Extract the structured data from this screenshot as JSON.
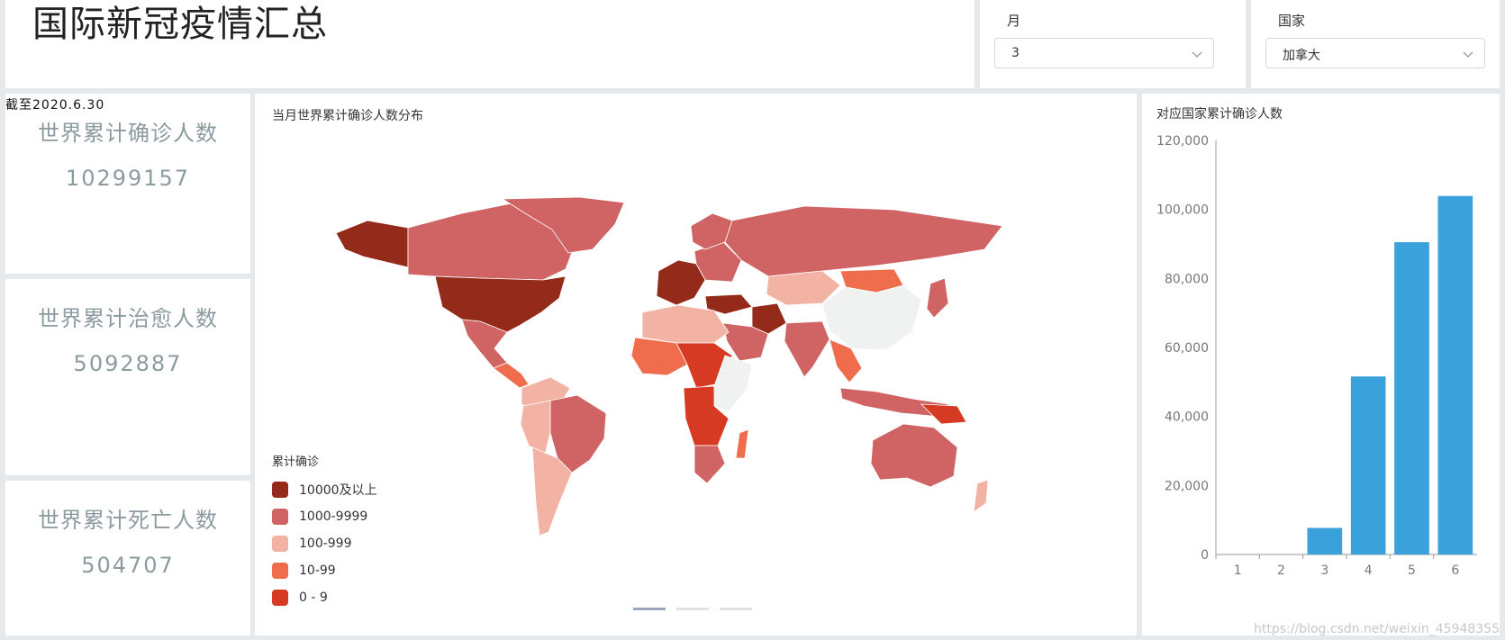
{
  "header": {
    "title": "国际新冠疫情汇总"
  },
  "filters": {
    "month": {
      "label": "月",
      "value": "3"
    },
    "country": {
      "label": "国家",
      "value": "加拿大"
    }
  },
  "as_of": "截至2020.6.30",
  "kpis": {
    "confirmed": {
      "label": "世界累计确诊人数",
      "value": "10299157"
    },
    "recovered": {
      "label": "世界累计治愈人数",
      "value": "5092887"
    },
    "deaths": {
      "label": "世界累计死亡人数",
      "value": "504707"
    }
  },
  "map": {
    "title": "当月世界累计确诊人数分布",
    "legend_title": "累计确诊",
    "legend": [
      {
        "label": "10000及以上",
        "color": "#942a1a"
      },
      {
        "label": "1000-9999",
        "color": "#d06464"
      },
      {
        "label": "100-999",
        "color": "#f2b3a4"
      },
      {
        "label": "10-99",
        "color": "#ef6d4c"
      },
      {
        "label": "0 - 9",
        "color": "#d63a22"
      }
    ],
    "no_data_color": "#f0f2f2"
  },
  "bar": {
    "title": "对应国家累计确诊人数"
  },
  "chart_data": {
    "type": "bar",
    "categories": [
      "1",
      "2",
      "3",
      "4",
      "5",
      "6"
    ],
    "values": [
      4,
      20,
      7700,
      51600,
      90500,
      103900
    ],
    "ylim": [
      0,
      120000
    ],
    "yticks": [
      0,
      20000,
      40000,
      60000,
      80000,
      100000,
      120000
    ],
    "ytick_labels": [
      "0",
      "20,000",
      "40,000",
      "60,000",
      "80,000",
      "100,000",
      "120,000"
    ],
    "bar_color": "#3ba1da",
    "grid": false
  },
  "watermark": "https://blog.csdn.net/weixin_45948355"
}
